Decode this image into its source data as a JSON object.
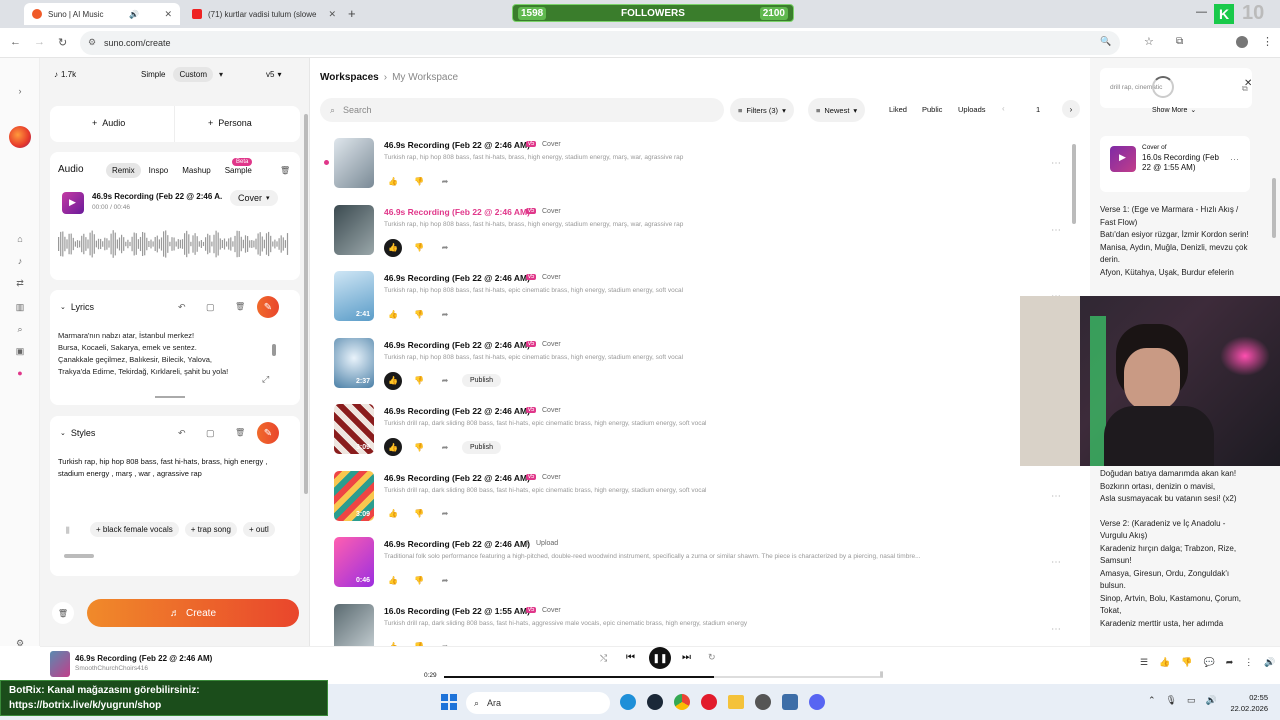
{
  "browser": {
    "tabs": [
      {
        "label": "Suno | AI Music",
        "active": true
      },
      {
        "label": "(71) kurtlar vadisi tulum (slowe",
        "active": false
      }
    ],
    "url": "suno.com/create"
  },
  "overlay": {
    "followers_current": "1598",
    "followers_label": "FOLLOWERS",
    "followers_goal": "2100",
    "corner_number": "10",
    "botrix_line1": "BotRix: Kanal mağazasını görebilirsiniz:",
    "botrix_line2": "https://botrix.live/k/yugrun/shop"
  },
  "left": {
    "credits": "1.7k",
    "mode_simple": "Simple",
    "mode_custom": "Custom",
    "version": "v5",
    "audio_button": "Audio",
    "persona_button": "Persona",
    "audio_section": {
      "title": "Audio",
      "tabs": [
        "Remix",
        "Inspo",
        "Mashup",
        "Sample"
      ],
      "beta": "Beta",
      "clip_title": "46.9s Recording (Feb 22 @ 2:46 A...",
      "clip_time": "00:00 / 00:46",
      "cover_select": "Cover"
    },
    "lyrics_section": {
      "title": "Lyrics",
      "lines": [
        "Marmara'nın nabzı atar, İstanbul merkez!",
        "Bursa, Kocaeli, Sakarya, emek ve sentez.",
        "Çanakkale geçilmez, Balıkesir, Bilecik, Yalova,",
        "Trakya'da Edirne, Tekirdağ, Kırklareli, şahit bu yola!"
      ]
    },
    "styles_section": {
      "title": "Styles",
      "text": "Turkish rap, hip hop  808 bass, fast hi-hats, brass, high energy , stadium energy , marş , war , agrassive rap",
      "chips": [
        "black female vocals",
        "trap song",
        "outl"
      ]
    },
    "create_button": "Create"
  },
  "main": {
    "breadcrumb_root": "Workspaces",
    "breadcrumb_current": "My Workspace",
    "search_placeholder": "Search",
    "filters": "Filters (3)",
    "sort": "Newest",
    "liked": "Liked",
    "public": "Public",
    "uploads": "Uploads",
    "page": "1",
    "songs": [
      {
        "title": "46.9s Recording (Feb 22 @ 2:46 AM)",
        "badge": "v5",
        "tag": "Cover",
        "desc": "Turkish rap, hip hop 808 bass, fast hi-hats, brass, high energy, stadium energy, marş, war, agrassive rap",
        "duration": "",
        "pink": false,
        "publish": false,
        "liked": false
      },
      {
        "title": "46.9s Recording (Feb 22 @ 2:46 AM)",
        "badge": "v5",
        "tag": "Cover",
        "desc": "Turkish rap, hip hop 808 bass, fast hi-hats, brass, high energy, stadium energy, marş, war, agrassive rap",
        "duration": "",
        "pink": true,
        "publish": false,
        "liked": true
      },
      {
        "title": "46.9s Recording (Feb 22 @ 2:46 AM)",
        "badge": "v5",
        "tag": "Cover",
        "desc": "Turkish rap, hip hop 808 bass, fast hi-hats, epic cinematic brass, high energy, stadium energy, soft vocal",
        "duration": "2:41",
        "pink": false,
        "publish": false,
        "liked": false
      },
      {
        "title": "46.9s Recording (Feb 22 @ 2:46 AM)",
        "badge": "v5",
        "tag": "Cover",
        "desc": "Turkish rap, hip hop 808 bass, fast hi-hats, epic cinematic brass, high energy, stadium energy, soft vocal",
        "duration": "2:37",
        "pink": false,
        "publish": true,
        "liked": true
      },
      {
        "title": "46.9s Recording (Feb 22 @ 2:46 AM)",
        "badge": "v5",
        "tag": "Cover",
        "desc": "Turkish drill rap, dark sliding 808 bass, fast hi-hats, epic cinematic brass, high energy, stadium energy, soft vocal",
        "duration": "3:09",
        "pink": false,
        "publish": true,
        "liked": true
      },
      {
        "title": "46.9s Recording (Feb 22 @ 2:46 AM)",
        "badge": "v5",
        "tag": "Cover",
        "desc": "Turkish drill rap, dark sliding 808 bass, fast hi-hats, epic cinematic brass, high energy, stadium energy, soft vocal",
        "duration": "3:09",
        "pink": false,
        "publish": false,
        "liked": false
      },
      {
        "title": "46.9s Recording (Feb 22 @ 2:46 AM)",
        "badge": "",
        "tag": "Upload",
        "desc": "Traditional folk solo performance featuring a high-pitched, double-reed woodwind instrument, specifically a zurna or similar shawm. The piece is characterized by a piercing, nasal timbre...",
        "duration": "0:46",
        "pink": false,
        "publish": false,
        "liked": false
      },
      {
        "title": "16.0s Recording (Feb 22 @ 1:55 AM)",
        "badge": "v5",
        "tag": "Cover",
        "desc": "Turkish drill rap, dark sliding 808 bass, fast hi-hats, aggressive male vocals, epic cinematic brass, high energy, stadium energy",
        "duration": "",
        "pink": false,
        "publish": false,
        "liked": false
      }
    ],
    "publish_label": "Publish"
  },
  "right": {
    "style_prompt": "drill rap, cinematic",
    "show_more": "Show More",
    "cover_of": "Cover of",
    "cover_title": "16.0s Recording (Feb 22 @ 1:55 AM)",
    "lyrics_top": [
      "Verse 1: (Ege ve Marmara - Hızlı Akış / Fast Flow)",
      "Batı'dan esiyor rüzgar, İzmir Kordon serin!",
      "Manisa, Aydın, Muğla, Denizli, mevzu çok derin.",
      "Afyon, Kütahya, Uşak, Burdur efelerin"
    ],
    "lyrics_bottom": [
      "Doğudan batıya damarımda akan kan!",
      "Bozkırın ortası, denizin o mavisi,",
      "Asla susmayacak bu vatanın sesi! (x2)",
      "",
      "Verse 2: (Karadeniz ve İç Anadolu - Vurgulu Akış)",
      "Karadeniz hırçın dalga; Trabzon, Rize, Samsun!",
      "Amasya, Giresun, Ordu, Zonguldak'ı bulsun.",
      "Sinop, Artvin, Bolu, Kastamonu, Çorum, Tokat,",
      "Karadeniz merttir usta, her adımda"
    ]
  },
  "player": {
    "title": "46.9s Recording (Feb 22 @ 2:46 AM)",
    "artist": "SmoothChurchChoirs416",
    "elapsed": "0:29",
    "progress": 0.62
  },
  "taskbar": {
    "search": "Ara",
    "time": "02:55",
    "date": "22.02.2026"
  },
  "colors": {
    "accent": "#e9462c",
    "pink": "#e0378a"
  }
}
